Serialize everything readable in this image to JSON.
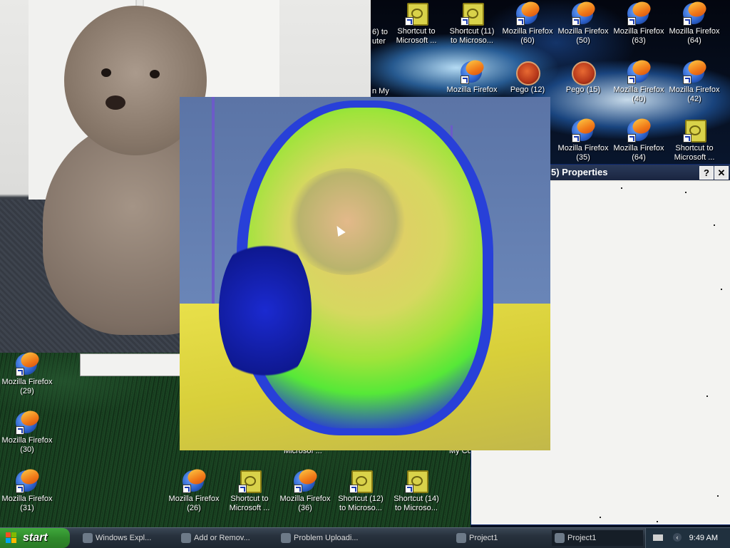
{
  "desktop": {
    "icons": [
      {
        "label_1": "Shortcut to",
        "label_2": "Microsoft ...",
        "type": "doc"
      },
      {
        "label_1": "Shortcut (11)",
        "label_2": "to Microso...",
        "type": "doc"
      },
      {
        "label_1": "Mozilla Firefox",
        "label_2": "(60)",
        "type": "firefox"
      },
      {
        "label_1": "Mozilla Firefox",
        "label_2": "(50)",
        "type": "firefox"
      },
      {
        "label_1": "Mozilla Firefox",
        "label_2": "(63)",
        "type": "firefox"
      },
      {
        "label_1": "Mozilla Firefox",
        "label_2": "(64)",
        "type": "firefox"
      },
      {
        "label_1": "Mozilla Firefox",
        "label_2": "",
        "type": "firefox"
      },
      {
        "label_1": "Pego (12)",
        "label_2": "",
        "type": "pego"
      },
      {
        "label_1": "Pego (15)",
        "label_2": "",
        "type": "pego"
      },
      {
        "label_1": "Mozilla Firefox",
        "label_2": "(40)",
        "type": "firefox"
      },
      {
        "label_1": "Mozilla Firefox",
        "label_2": "(42)",
        "type": "firefox"
      },
      {
        "label_1": "Mozilla Firefox",
        "label_2": "(35)",
        "type": "firefox"
      },
      {
        "label_1": "Mozilla Firefox",
        "label_2": "(64)",
        "type": "firefox"
      },
      {
        "label_1": "Shortcut to",
        "label_2": "Microsoft ...",
        "type": "doc"
      },
      {
        "label_1": "Mozilla Firefox",
        "label_2": "(29)",
        "type": "firefox"
      },
      {
        "label_1": "Mozilla Firefox",
        "label_2": "(30)",
        "type": "firefox"
      },
      {
        "label_1": "Mozilla Firefox",
        "label_2": "(31)",
        "type": "firefox"
      },
      {
        "label_1": "Mozilla Firefox",
        "label_2": "(26)",
        "type": "firefox"
      },
      {
        "label_1": "Shortcut to",
        "label_2": "Microsoft ...",
        "type": "doc"
      },
      {
        "label_1": "Mozilla Firefox",
        "label_2": "(36)",
        "type": "firefox"
      },
      {
        "label_1": "Shortcut (12)",
        "label_2": "to Microso...",
        "type": "doc"
      },
      {
        "label_1": "Shortcut (14)",
        "label_2": "to Microso...",
        "type": "doc"
      }
    ],
    "fragments": {
      "top_left_1": "6) to",
      "top_left_2": "uter",
      "my": "n My",
      "microsof": "Microsof ...",
      "myco": "My Co"
    }
  },
  "properties_window": {
    "title": "5) Properties",
    "help_label": "?",
    "close_label": "✕"
  },
  "taskbar": {
    "start_label": "start",
    "tasks": [
      {
        "label": "Windows Expl..."
      },
      {
        "label": "Add or Remov..."
      },
      {
        "label": "Problem Uploadi..."
      },
      {
        "label": "Project1"
      },
      {
        "label": "Project1"
      }
    ],
    "clock": "9:49 AM"
  },
  "colors": {
    "start_green": "#2f8a2b",
    "titlebar": "#1a2540"
  }
}
